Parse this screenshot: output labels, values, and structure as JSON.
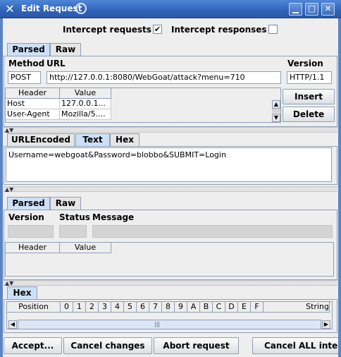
{
  "window": {
    "title": "Edit Request",
    "icons": {
      "app": "x-app-icon",
      "minimize": "minimize-icon",
      "maximize": "maximize-icon",
      "close": "close-icon"
    }
  },
  "intercept": {
    "requests_label": "Intercept requests :",
    "requests_checked": "✔",
    "responses_label": "Intercept responses :",
    "responses_checked": ""
  },
  "request": {
    "tabs": [
      "Parsed",
      "Raw"
    ],
    "method_label": "Method",
    "url_label": "URL",
    "version_label": "Version",
    "method": "POST",
    "url": "http://127.0.0.1:8080/WebGoat/attack?menu=710",
    "version": "HTTP/1.1",
    "headers": {
      "columns": [
        "Header",
        "Value"
      ],
      "rows": [
        {
          "header": "Host",
          "value": "127.0.0.1..."
        },
        {
          "header": "User-Agent",
          "value": "Mozilla/5...."
        }
      ]
    },
    "insert_label": "Insert",
    "delete_label": "Delete",
    "body_tabs": [
      "URLEncoded",
      "Text",
      "Hex"
    ],
    "body_text": "Username=webgoat&Password=blobbo&SUBMIT=Login"
  },
  "response": {
    "tabs": [
      "Parsed",
      "Raw"
    ],
    "version_label": "Version",
    "status_label": "Status",
    "message_label": "Message",
    "headers": {
      "columns": [
        "Header",
        "Value"
      ]
    },
    "hex_tab": "Hex",
    "hex_columns": [
      "Position",
      "0",
      "1",
      "2",
      "3",
      "4",
      "5",
      "6",
      "7",
      "8",
      "9",
      "A",
      "B",
      "C",
      "D",
      "E",
      "F",
      "String"
    ]
  },
  "buttons": {
    "accept": "Accept...",
    "cancel_changes": "Cancel changes",
    "abort_request": "Abort request",
    "cancel_all": "Cancel ALL intercepts"
  }
}
